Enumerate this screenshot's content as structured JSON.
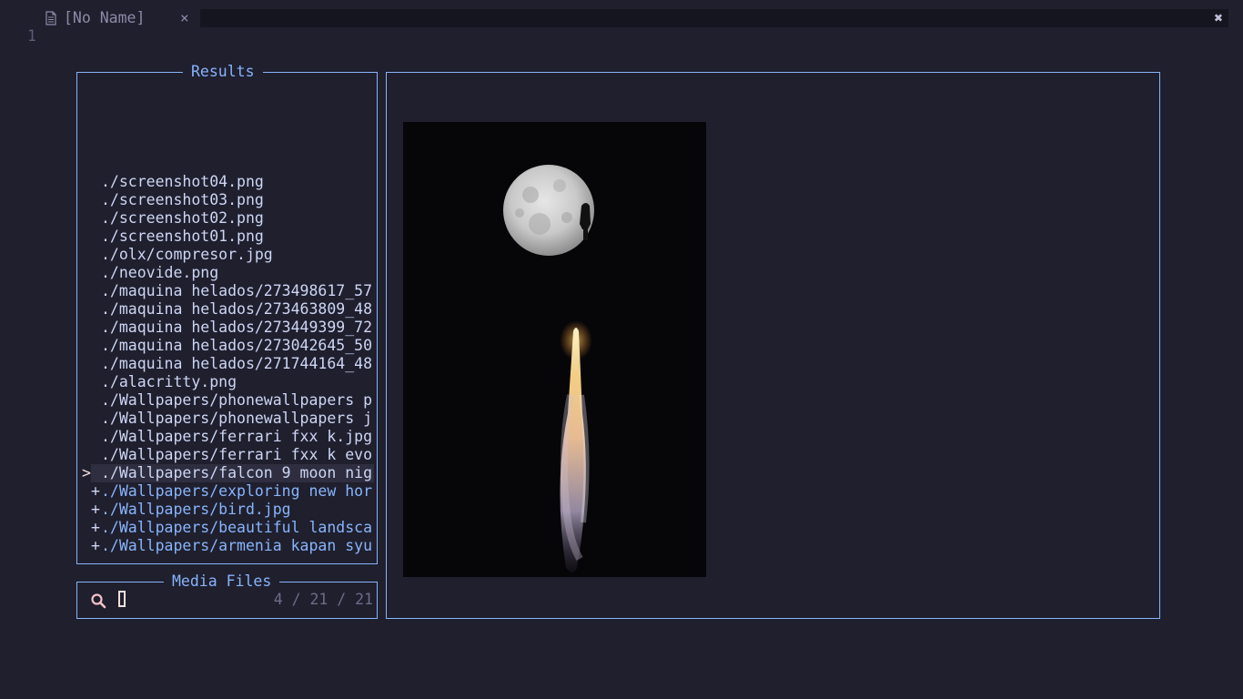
{
  "tab": {
    "label": "[No Name]",
    "close_glyph": "×",
    "icon": "file-icon"
  },
  "close_all_glyph": "✖",
  "line_number": "1",
  "results": {
    "title": "Results",
    "items": [
      {
        "marker": "",
        "path": "./screenshot04.png",
        "state": "normal"
      },
      {
        "marker": "",
        "path": "./screenshot03.png",
        "state": "normal"
      },
      {
        "marker": "",
        "path": "./screenshot02.png",
        "state": "normal"
      },
      {
        "marker": "",
        "path": "./screenshot01.png",
        "state": "normal"
      },
      {
        "marker": "",
        "path": "./olx/compresor.jpg",
        "state": "normal"
      },
      {
        "marker": "",
        "path": "./neovide.png",
        "state": "normal"
      },
      {
        "marker": "",
        "path": "./maquina helados/273498617_57",
        "state": "normal"
      },
      {
        "marker": "",
        "path": "./maquina helados/273463809_48",
        "state": "normal"
      },
      {
        "marker": "",
        "path": "./maquina helados/273449399_72",
        "state": "normal"
      },
      {
        "marker": "",
        "path": "./maquina helados/273042645_50",
        "state": "normal"
      },
      {
        "marker": "",
        "path": "./maquina helados/271744164_48",
        "state": "normal"
      },
      {
        "marker": "",
        "path": "./alacritty.png",
        "state": "normal"
      },
      {
        "marker": "",
        "path": "./Wallpapers/phonewallpapers p",
        "state": "normal"
      },
      {
        "marker": "",
        "path": "./Wallpapers/phonewallpapers j",
        "state": "normal"
      },
      {
        "marker": "",
        "path": "./Wallpapers/ferrari fxx k.jpg",
        "state": "normal"
      },
      {
        "marker": "",
        "path": "./Wallpapers/ferrari fxx k evo",
        "state": "normal"
      },
      {
        "marker": ">",
        "path": "./Wallpapers/falcon 9 moon nig",
        "state": "selected"
      },
      {
        "marker": "+",
        "path": "./Wallpapers/exploring new hor",
        "state": "untracked"
      },
      {
        "marker": "+",
        "path": "./Wallpapers/bird.jpg",
        "state": "untracked"
      },
      {
        "marker": "+",
        "path": "./Wallpapers/beautiful landsca",
        "state": "untracked"
      },
      {
        "marker": "+",
        "path": "./Wallpapers/armenia kapan syu",
        "state": "untracked"
      }
    ]
  },
  "prompt": {
    "title": "Media Files",
    "icon": "search-icon",
    "query": "",
    "counter": "4 / 21 / 21"
  },
  "preview": {
    "image": "falcon 9 launch in front of full moon"
  },
  "colors": {
    "background": "#1f1f2e",
    "border": "#89b4fa",
    "title": "#89b4fa",
    "untracked": "#89b4fa",
    "cursor": "#f5e0dc",
    "search_icon": "#f5c2c8"
  }
}
